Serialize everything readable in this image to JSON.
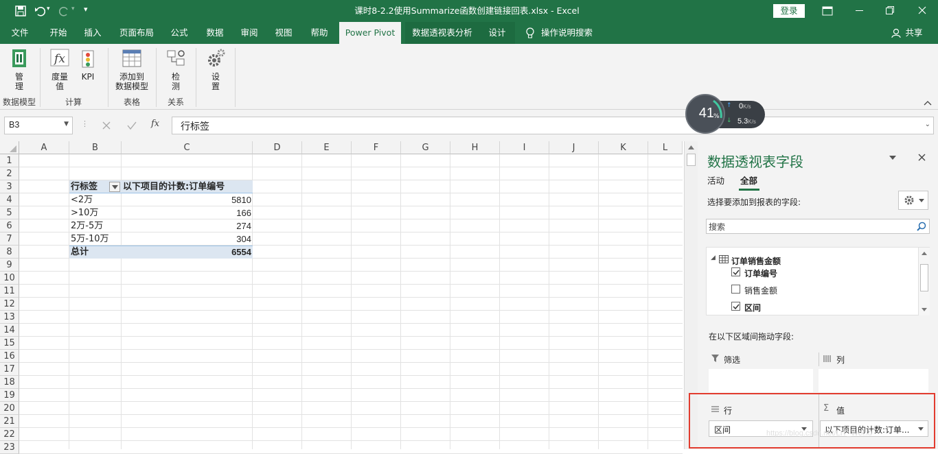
{
  "titlebar": {
    "title": "课时8-2.2使用Summarize函数创建链接回表.xlsx  -  Excel",
    "login": "登录",
    "customize": "▾"
  },
  "tabs": [
    "文件",
    "开始",
    "插入",
    "页面布局",
    "公式",
    "数据",
    "审阅",
    "视图",
    "帮助",
    "Power Pivot",
    "数据透视表分析",
    "设计"
  ],
  "tell_me": "操作说明搜索",
  "share": "共享",
  "ribbon": {
    "manage": "管\n理",
    "group_datamodel": "数据模型",
    "measures": "度量\n值",
    "kpi": "KPI",
    "group_calc": "计算",
    "add_to_model": "添加到\n数据模型",
    "group_table": "表格",
    "detect": "检\n测",
    "group_relations": "关系",
    "settings": "设\n置"
  },
  "net_widget": {
    "percent": "41",
    "percent_unit": "%",
    "up": "0",
    "down": "5.3",
    "unit": "K/s"
  },
  "formula": {
    "namebox": "B3",
    "fx": "fx",
    "content": "行标签"
  },
  "columns": [
    "A",
    "B",
    "C",
    "D",
    "E",
    "F",
    "G",
    "H",
    "I",
    "J",
    "K",
    "L"
  ],
  "rows": [
    "1",
    "2",
    "3",
    "4",
    "5",
    "6",
    "7",
    "8",
    "9",
    "10",
    "11",
    "12",
    "13",
    "14",
    "15",
    "16",
    "17",
    "18",
    "19",
    "20",
    "21",
    "22",
    "23"
  ],
  "pivot": {
    "header_label": "行标签",
    "header_value": "以下项目的计数:订单编号",
    "items": [
      {
        "label": "<2万",
        "value": "5810"
      },
      {
        "label": ">10万",
        "value": "166"
      },
      {
        "label": "2万-5万",
        "value": "274"
      },
      {
        "label": "5万-10万",
        "value": "304"
      }
    ],
    "total_label": "总计",
    "total_value": "6554"
  },
  "field_pane": {
    "title": "数据透视表字段",
    "tab_active": "活动",
    "tab_all": "全部",
    "choose_label": "选择要添加到报表的字段:",
    "search_placeholder": "搜索",
    "table_name": "订单销售金额",
    "fields": [
      {
        "name": "订单编号",
        "checked": true
      },
      {
        "name": "销售金额",
        "checked": false
      },
      {
        "name": "区间",
        "checked": true
      }
    ],
    "drag_label": "在以下区域间拖动字段:",
    "filters_label": "筛选",
    "columns_label": "列",
    "rows_label": "行",
    "values_label": "值",
    "row_field": "区间",
    "value_field": "以下项目的计数:订单..."
  },
  "watermark": "https://blog.csdn.net/LIT_Wei.lu",
  "highlight_color": "#e23b2e"
}
